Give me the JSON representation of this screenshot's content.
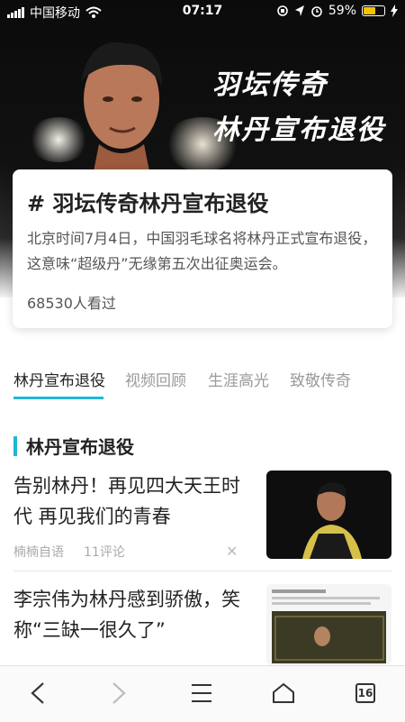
{
  "status_bar": {
    "carrier": "中国移动",
    "time": "07:17",
    "battery_percent": "59%",
    "battery_level": 0.59,
    "battery_color": "#f5c400"
  },
  "hero": {
    "title_line1": "羽坛传奇",
    "title_line2": "林丹宣布退役"
  },
  "topic_card": {
    "title": "# 羽坛传奇林丹宣布退役",
    "description": "北京时间7月4日，中国羽毛球名将林丹正式宣布退役，这意味“超级丹”无缘第五次出征奥运会。",
    "views": "68530人看过"
  },
  "tabs": [
    {
      "label": "林丹宣布退役",
      "active": true
    },
    {
      "label": "视频回顾",
      "active": false
    },
    {
      "label": "生涯高光",
      "active": false
    },
    {
      "label": "致敬传奇",
      "active": false
    }
  ],
  "section": {
    "title": "林丹宣布退役",
    "accent_color": "#1fb7d6"
  },
  "news": [
    {
      "headline": "告别林丹！再见四大天王时代 再见我们的青春",
      "source": "楠楠自语",
      "comments": "11评论",
      "close_icon": "close-icon"
    },
    {
      "headline": "李宗伟为林丹感到骄傲，笑称“三缺一很久了”",
      "source": "",
      "comments": ""
    }
  ],
  "bottom_bar": {
    "tab_count": "16",
    "icons": [
      "back-icon",
      "forward-icon",
      "menu-icon",
      "home-icon",
      "tabs-icon"
    ]
  }
}
